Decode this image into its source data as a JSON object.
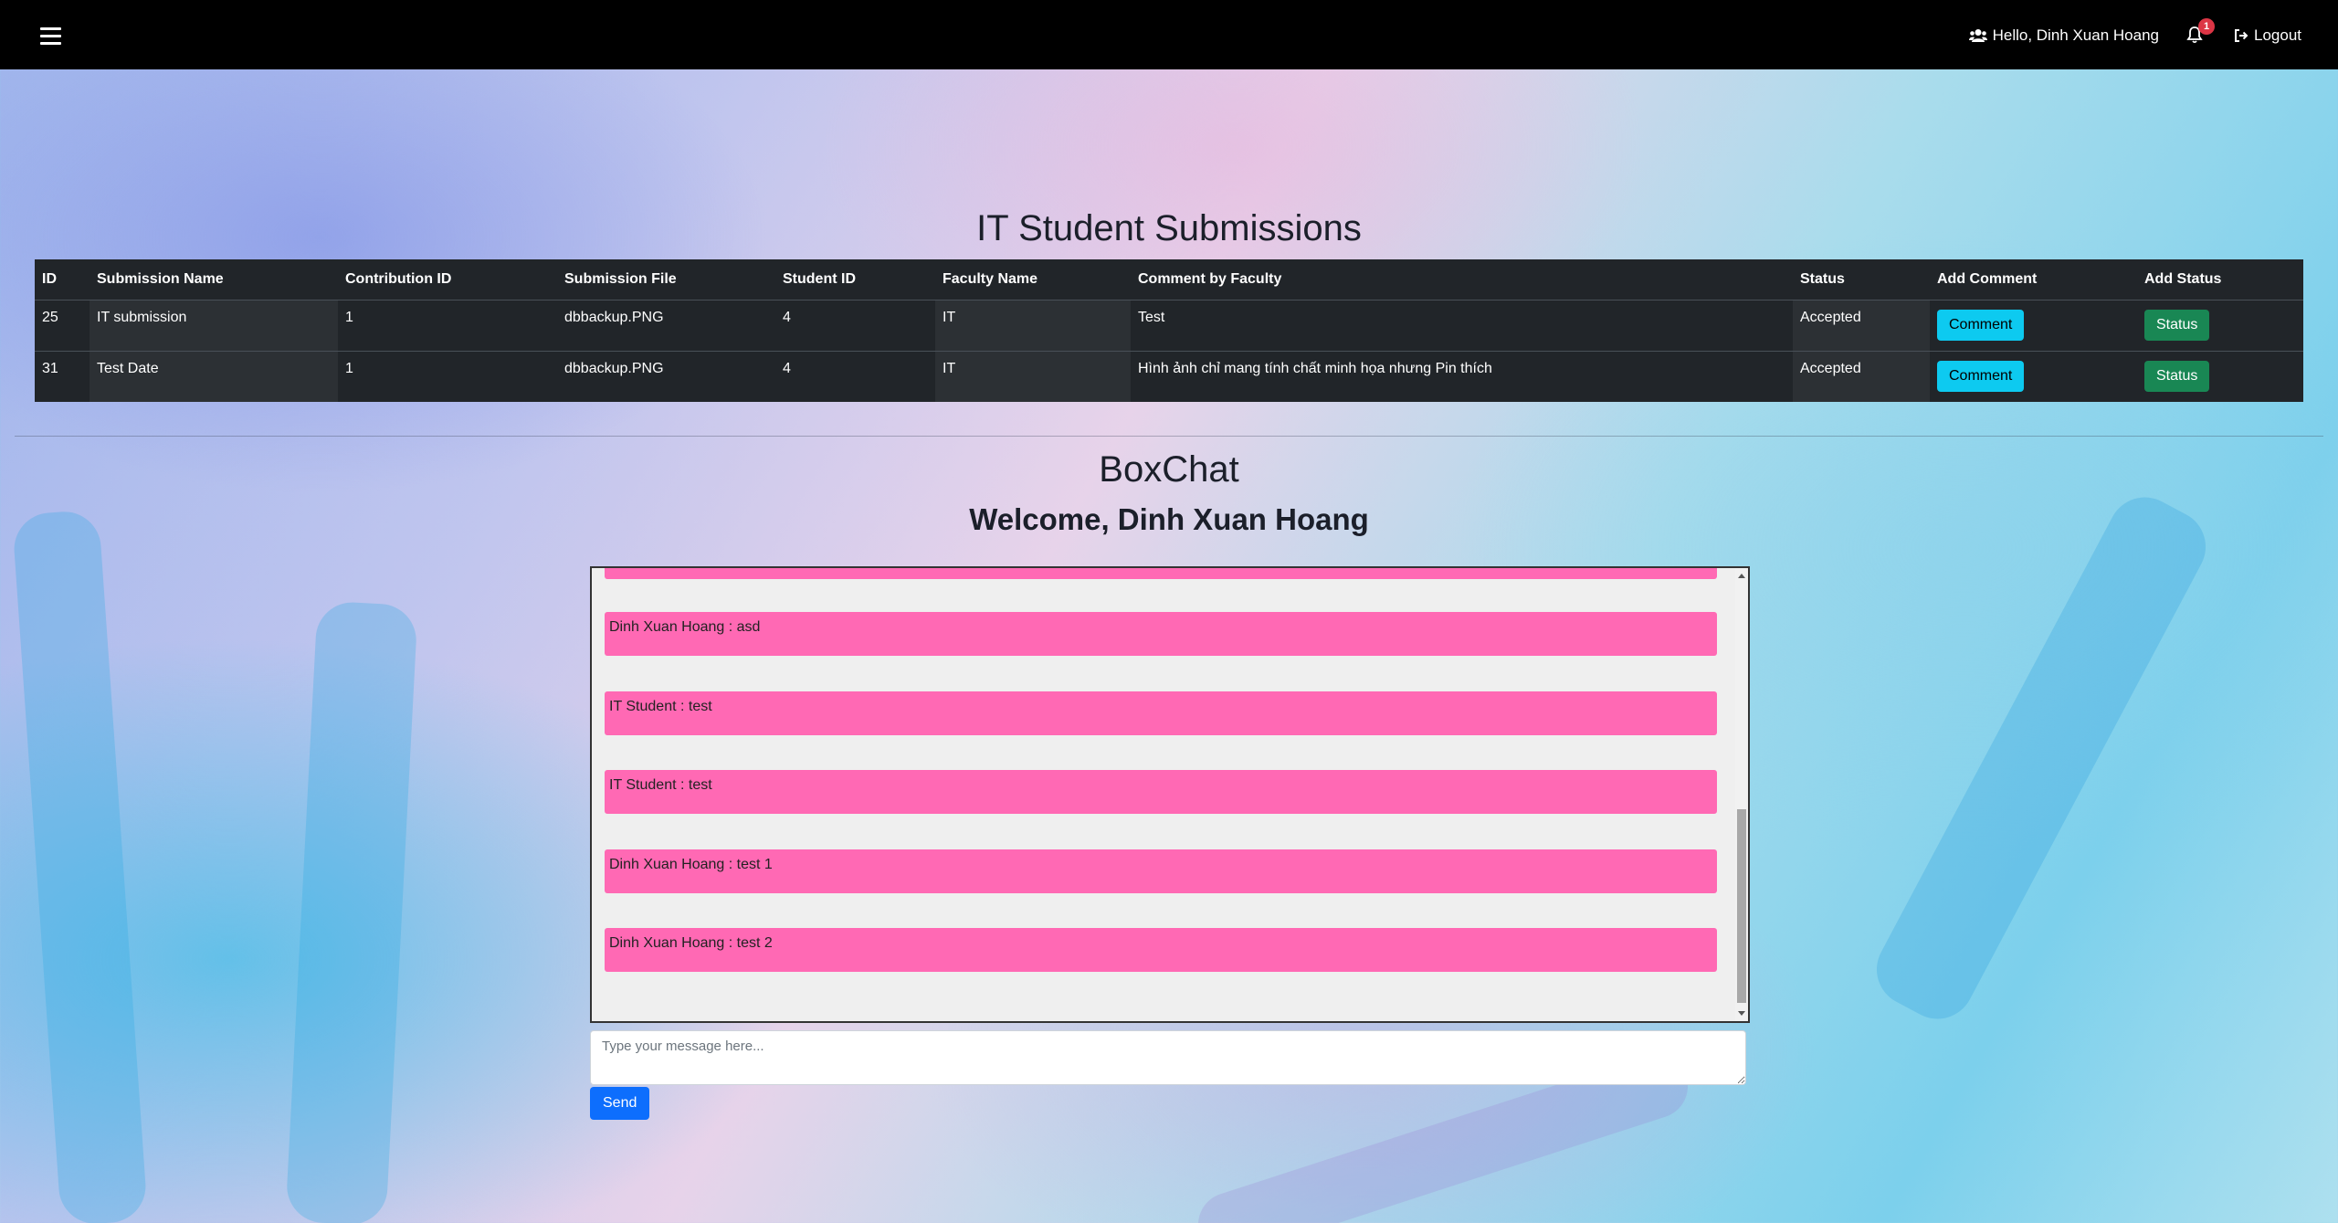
{
  "navbar": {
    "greeting": "Hello, Dinh Xuan Hoang",
    "notification_count": "1",
    "logout_label": "Logout"
  },
  "submissions": {
    "title": "IT Student Submissions",
    "columns": [
      "ID",
      "Submission Name",
      "Contribution ID",
      "Submission File",
      "Student ID",
      "Faculty Name",
      "Comment by Faculty",
      "Status",
      "Add Comment",
      "Add Status"
    ],
    "rows": [
      {
        "id": "25",
        "name": "IT submission",
        "contribution_id": "1",
        "file": "dbbackup.PNG",
        "student_id": "4",
        "faculty": "IT",
        "comment": "Test",
        "status": "Accepted",
        "comment_btn": "Comment",
        "status_btn": "Status"
      },
      {
        "id": "31",
        "name": "Test Date",
        "contribution_id": "1",
        "file": "dbbackup.PNG",
        "student_id": "4",
        "faculty": "IT",
        "comment": "Hình ảnh chỉ mang tính chất minh họa nhưng Pin thích",
        "status": "Accepted",
        "comment_btn": "Comment",
        "status_btn": "Status"
      }
    ]
  },
  "chat": {
    "title": "BoxChat",
    "welcome": "Welcome, Dinh Xuan Hoang",
    "messages": [
      "",
      "Dinh Xuan Hoang : asd",
      "IT Student : test",
      "IT Student : test",
      "Dinh Xuan Hoang : test 1",
      "Dinh Xuan Hoang : test 2"
    ],
    "input_placeholder": "Type your message here...",
    "send_label": "Send"
  },
  "colors": {
    "navbar": "#000000",
    "table": "#212529",
    "message_bubble": "#ff69b4",
    "comment_button": "#0dcaf0",
    "status_button": "#198754",
    "send_button": "#0d6efd",
    "badge": "#dc3545"
  },
  "icons": {
    "menu": "hamburger-icon",
    "user": "users-icon",
    "notifications": "bell-icon",
    "logout": "sign-out-icon"
  }
}
